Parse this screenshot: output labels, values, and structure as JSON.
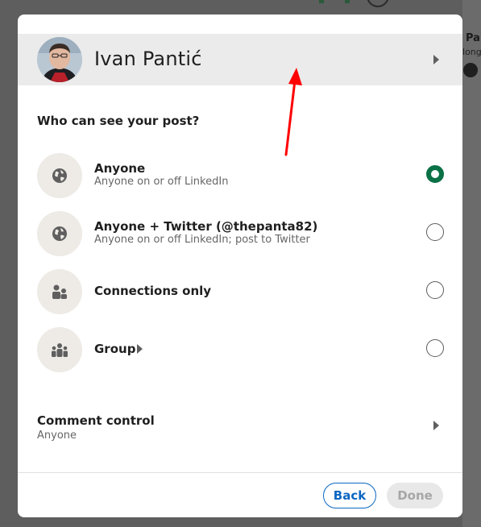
{
  "background_peek": {
    "name_fragment": "Pa",
    "subtitle_fragment": "longe"
  },
  "author": {
    "name": "Ivan Pantić"
  },
  "visibility": {
    "question": "Who can see your post?",
    "options": [
      {
        "title": "Anyone",
        "subtitle": "Anyone on or off LinkedIn",
        "icon": "globe-icon",
        "selected": true
      },
      {
        "title": "Anyone + Twitter (@thepanta82)",
        "subtitle": "Anyone on or off LinkedIn; post to Twitter",
        "icon": "globe-icon",
        "selected": false
      },
      {
        "title": "Connections only",
        "subtitle": "",
        "icon": "people-icon",
        "selected": false
      },
      {
        "title": "Group",
        "subtitle": "",
        "icon": "group-icon",
        "selected": false
      }
    ]
  },
  "comment_control": {
    "title": "Comment control",
    "value": "Anyone"
  },
  "footer": {
    "back_label": "Back",
    "done_label": "Done"
  },
  "colors": {
    "selected_radio": "#0b7046",
    "primary": "#0a66c2",
    "annotation_arrow": "#ff0000"
  }
}
